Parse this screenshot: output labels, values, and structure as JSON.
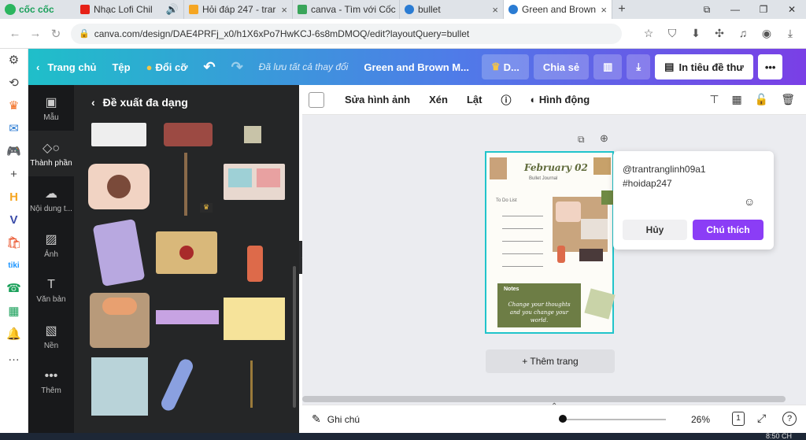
{
  "browser": {
    "logo": "cốc cốc",
    "tabs": [
      {
        "label": "Nhạc Lofi Chil",
        "color": "#e62117"
      },
      {
        "label": "Hỏi đáp 247 - trar",
        "color": "#f5a623"
      },
      {
        "label": "canva - Tìm với Cốc",
        "color": "#3aa55a"
      },
      {
        "label": "bullet",
        "color": "#2b7cd3"
      },
      {
        "label": "Green and Brown",
        "color": "#2b7cd3"
      }
    ],
    "url": "canva.com/design/DAE4PRFj_x0/h1X6xPo7HwKCJ-6s8mDMOQ/edit?layoutQuery=bullet"
  },
  "header": {
    "home": "Trang chủ",
    "file": "Tệp",
    "resize": "Đổi cỡ",
    "saved": "Đã lưu tất cả thay đổi",
    "title": "Green and Brown M...",
    "premium": "D...",
    "share": "Chia sẻ",
    "print": "In tiêu đề thư"
  },
  "sidenav": [
    {
      "label": "Mẫu",
      "icon": "template-icon"
    },
    {
      "label": "Thành phần",
      "icon": "elements-icon"
    },
    {
      "label": "Nội dung t...",
      "icon": "upload-icon"
    },
    {
      "label": "Ảnh",
      "icon": "photo-icon"
    },
    {
      "label": "Văn bản",
      "icon": "text-icon"
    },
    {
      "label": "Nền",
      "icon": "background-icon"
    },
    {
      "label": "Thêm",
      "icon": "more-icon"
    }
  ],
  "panel": {
    "title": "Đề xuất đa dạng"
  },
  "toolbar": {
    "edit_image": "Sửa hình ảnh",
    "crop": "Xén",
    "flip": "Lật",
    "animate": "Hình động"
  },
  "page": {
    "date": "February 02",
    "subtitle": "Bullet Journal",
    "todo": "To Do List",
    "notes": "Notes",
    "quote": "Change your thoughts and you change your world."
  },
  "comment": {
    "user": "@trantranglinh09a1",
    "tag": "#hoidap247",
    "cancel": "Hủy",
    "submit": "Chú thích"
  },
  "add_page": "+ Thêm trang",
  "footer": {
    "notes": "Ghi chú",
    "zoom": "26%",
    "pages": "1"
  },
  "taskbar": {
    "time": "8:50 CH"
  }
}
